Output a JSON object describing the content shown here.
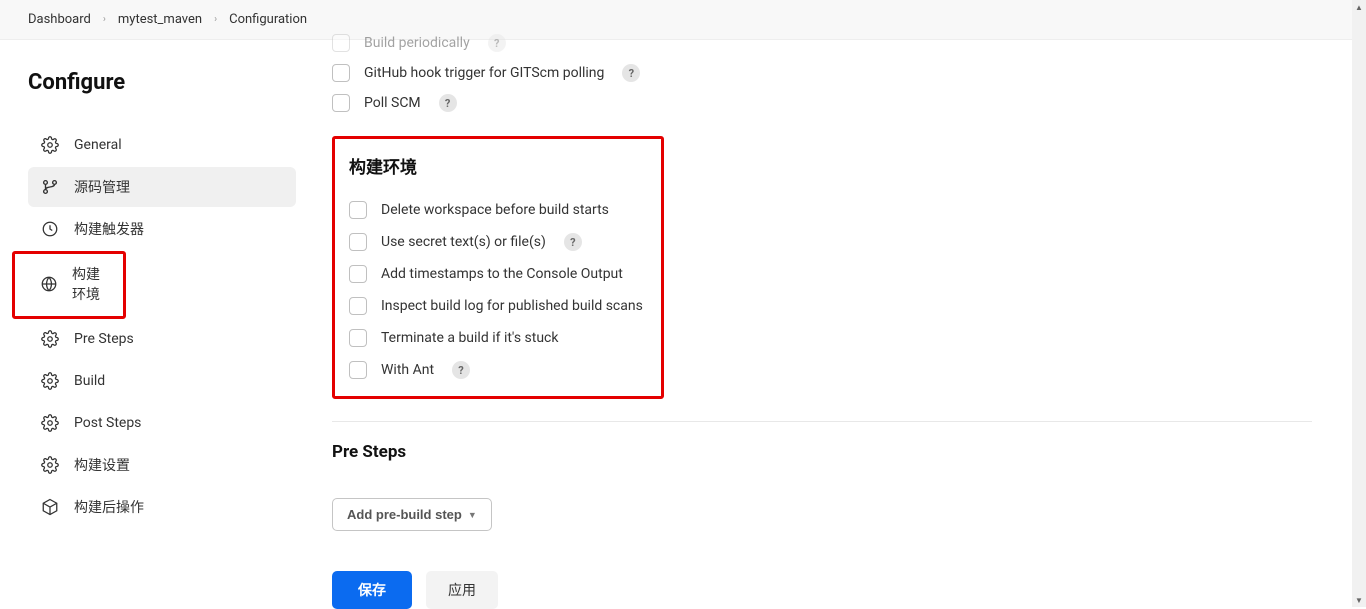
{
  "breadcrumb": {
    "dashboard": "Dashboard",
    "project": "mytest_maven",
    "page": "Configuration"
  },
  "page_title": "Configure",
  "sidebar": {
    "items": [
      {
        "label": "General"
      },
      {
        "label": "源码管理"
      },
      {
        "label": "构建触发器"
      },
      {
        "label": "构建环境"
      },
      {
        "label": "Pre Steps"
      },
      {
        "label": "Build"
      },
      {
        "label": "Post Steps"
      },
      {
        "label": "构建设置"
      },
      {
        "label": "构建后操作"
      }
    ]
  },
  "triggers": {
    "items": [
      {
        "label": "Build periodically",
        "help": "?"
      },
      {
        "label": "GitHub hook trigger for GITScm polling",
        "help": "?"
      },
      {
        "label": "Poll SCM",
        "help": "?"
      }
    ]
  },
  "build_env": {
    "title": "构建环境",
    "items": [
      {
        "label": "Delete workspace before build starts"
      },
      {
        "label": "Use secret text(s) or file(s)",
        "help": "?"
      },
      {
        "label": "Add timestamps to the Console Output"
      },
      {
        "label": "Inspect build log for published build scans"
      },
      {
        "label": "Terminate a build if it's stuck"
      },
      {
        "label": "With Ant",
        "help": "?"
      }
    ]
  },
  "pre_steps": {
    "title": "Pre Steps",
    "add_button": "Add pre-build step"
  },
  "footer": {
    "save": "保存",
    "apply": "应用"
  }
}
